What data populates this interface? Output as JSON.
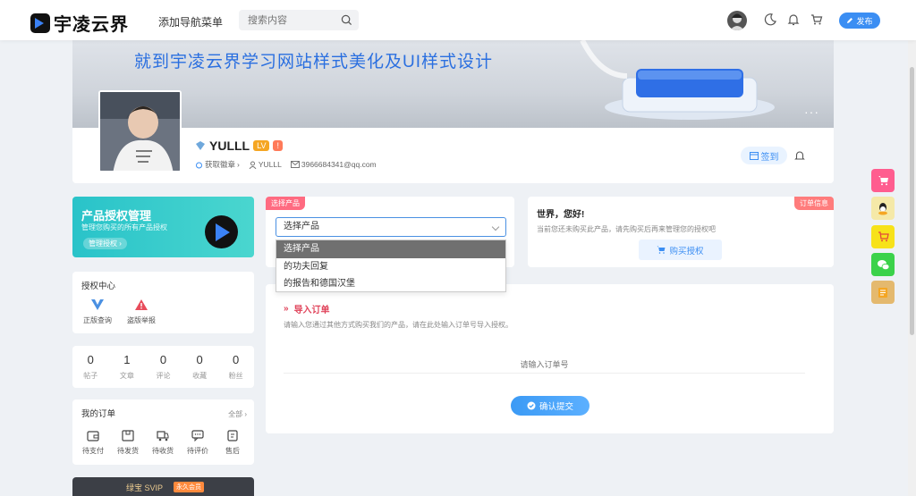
{
  "header": {
    "logo_text": "宇凌云界",
    "nav_label": "添加导航菜单",
    "search_placeholder": "搜索内容",
    "publish_label": "发布"
  },
  "profile": {
    "banner_title": "就到宇凌云界学习网站样式美化及UI样式设计",
    "username": "YULLL",
    "level_badge": "LV",
    "warn_badge": "!",
    "medal_link": "获取徽章",
    "user_id": "YULLL",
    "email": "3966684341@qq.com",
    "checkin_label": "签到"
  },
  "product_card": {
    "title": "产品授权管理",
    "subtitle": "管理您购买的所有产品授权",
    "button": "管理授权"
  },
  "auth_center": {
    "title": "授权中心",
    "items": [
      "正版查询",
      "盗版举报"
    ]
  },
  "stats": [
    {
      "value": "0",
      "label": "帖子"
    },
    {
      "value": "1",
      "label": "文章"
    },
    {
      "value": "0",
      "label": "评论"
    },
    {
      "value": "0",
      "label": "收藏"
    },
    {
      "value": "0",
      "label": "粉丝"
    }
  ],
  "orders": {
    "title": "我的订单",
    "all_label": "全部",
    "items": [
      "待支付",
      "待发货",
      "待收货",
      "待评价",
      "售后"
    ]
  },
  "svip": {
    "label": "绿宝 SVIP",
    "badge": "永久会员"
  },
  "select_product": {
    "tag": "选择产品",
    "current": "选择产品",
    "options": [
      "选择产品",
      "的功夫回复",
      "的报告和德国汉堡"
    ]
  },
  "hello": {
    "tag": "订单信息",
    "title": "世界，您好!",
    "subtitle": "当前您还未购买此产品，请先购买后再来管理您的授权吧",
    "buy_button": "购买授权"
  },
  "import_order": {
    "title": "导入订单",
    "description": "请输入您通过其他方式购买我们的产品，请在此处输入订单号导入授权。",
    "input_placeholder": "请输入订单号",
    "confirm_button": "确认提交"
  },
  "colors": {
    "accent": "#3b8ef3",
    "product_gradient": "#29c3c9",
    "tag_pink": "#ff6b81"
  }
}
